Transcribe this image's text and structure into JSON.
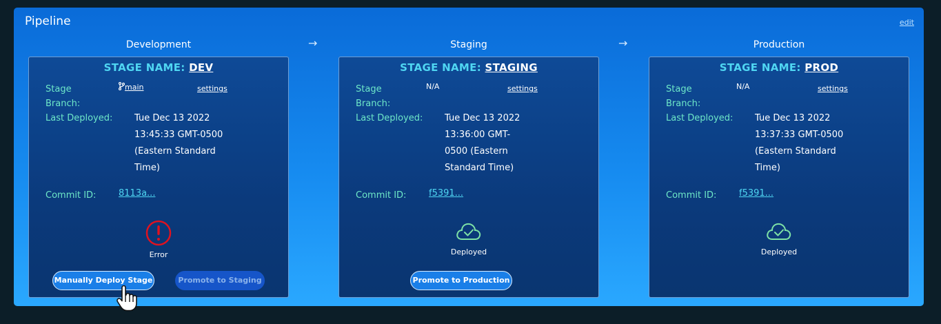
{
  "panel": {
    "title": "Pipeline",
    "edit_label": "edit"
  },
  "arrow_glyph": "→",
  "stage_name_prefix": "STAGE NAME:",
  "labels": {
    "stage_branch": "Stage\nBranch:",
    "last_deployed": "Last Deployed:",
    "commit_id": "Commit ID:",
    "settings": "settings"
  },
  "stages": [
    {
      "title": "Development",
      "stage_name": "DEV",
      "branch": "main",
      "last_deployed": "Tue Dec 13 2022\n13:45:33 GMT-0500\n(Eastern Standard\nTime)",
      "commit_id": "8113a...",
      "status": "Error",
      "status_icon": "error-icon",
      "status_color": "#e0121f",
      "buttons": [
        {
          "label": "Manually Deploy Stage",
          "style": "primary"
        },
        {
          "label": "Promote to Staging",
          "style": "disabled"
        }
      ]
    },
    {
      "title": "Staging",
      "stage_name": "STAGING",
      "branch": "N/A",
      "last_deployed": "Tue Dec 13 2022\n13:36:00 GMT-\n0500 (Eastern\nStandard Time)",
      "commit_id": "f5391...",
      "status": "Deployed",
      "status_icon": "cloud-check-icon",
      "status_color": "#7ee2a6",
      "buttons": [
        {
          "label": "Promote to Production",
          "style": "primary"
        }
      ]
    },
    {
      "title": "Production",
      "stage_name": "PROD",
      "branch": "N/A",
      "last_deployed": "Tue Dec 13 2022\n13:37:33 GMT-0500\n(Eastern Standard\nTime)",
      "commit_id": "f5391...",
      "status": "Deployed",
      "status_icon": "cloud-check-icon",
      "status_color": "#7ee2a6",
      "buttons": []
    }
  ],
  "colors": {
    "accent_cyan": "#4fd6f2",
    "label_green": "#6ee8c8",
    "panel_blue": "#168bf0",
    "card_navy": "#0b3a7c"
  }
}
